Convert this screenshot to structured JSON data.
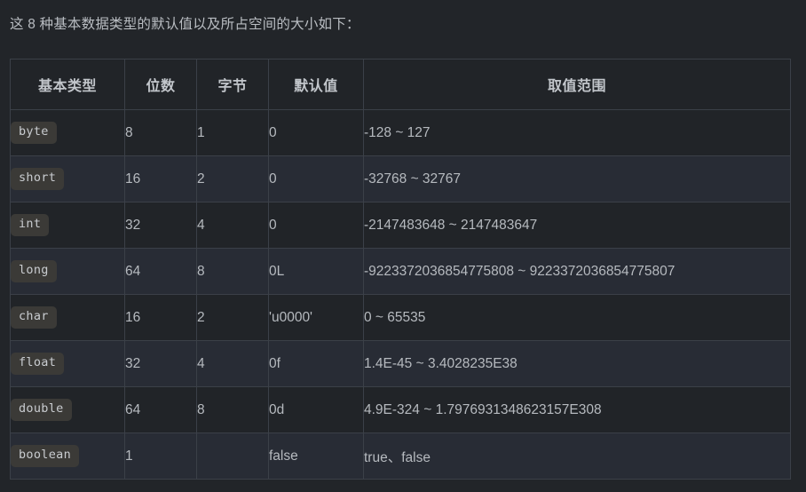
{
  "intro": {
    "text": "这 8 种基本数据类型的默认值以及所占空间的大小如下："
  },
  "colors": {
    "page_background": "#222529",
    "row_odd_background": "#212428",
    "row_even_background": "#282c35",
    "border": "#3b4048",
    "text": "#b6babf",
    "header_text": "#c2c6cb",
    "code_badge_background": "#3b3a37",
    "code_badge_text": "#c9ccd0"
  },
  "table": {
    "headers": [
      "基本类型",
      "位数",
      "字节",
      "默认值",
      "取值范围"
    ],
    "rows": [
      {
        "type": "byte",
        "bits": "8",
        "bytes": "1",
        "default": "0",
        "range": "-128 ~ 127"
      },
      {
        "type": "short",
        "bits": "16",
        "bytes": "2",
        "default": "0",
        "range": "-32768 ~ 32767"
      },
      {
        "type": "int",
        "bits": "32",
        "bytes": "4",
        "default": "0",
        "range": "-2147483648 ~ 2147483647"
      },
      {
        "type": "long",
        "bits": "64",
        "bytes": "8",
        "default": "0L",
        "range": "-9223372036854775808 ~ 9223372036854775807"
      },
      {
        "type": "char",
        "bits": "16",
        "bytes": "2",
        "default": "'u0000'",
        "range": "0 ~ 65535"
      },
      {
        "type": "float",
        "bits": "32",
        "bytes": "4",
        "default": "0f",
        "range": "1.4E-45 ~ 3.4028235E38"
      },
      {
        "type": "double",
        "bits": "64",
        "bytes": "8",
        "default": "0d",
        "range": "4.9E-324 ~ 1.7976931348623157E308"
      },
      {
        "type": "boolean",
        "bits": "1",
        "bytes": "",
        "default": "false",
        "range": "true、false"
      }
    ]
  }
}
